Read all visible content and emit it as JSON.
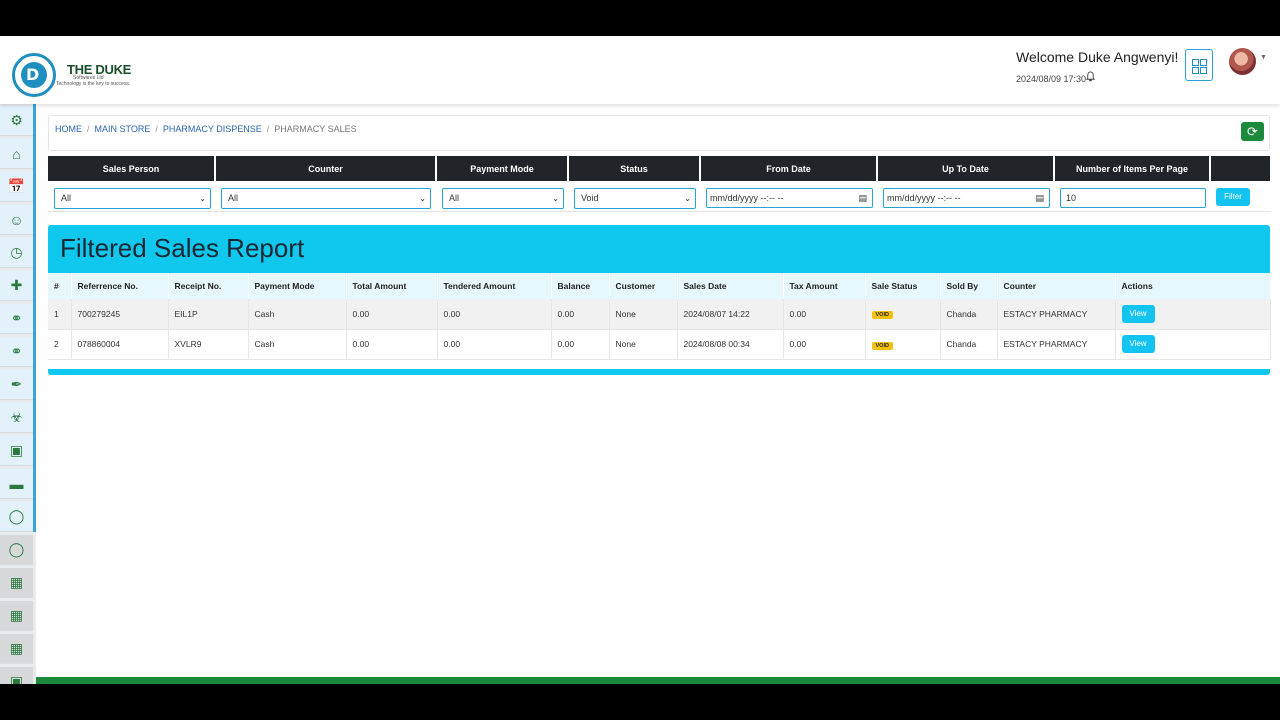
{
  "brand": {
    "name": "THE DUKE",
    "sub": "Softwares Ltd",
    "tagline": "Technology is the key to success.",
    "logo_letter": "D"
  },
  "header": {
    "welcome": "Welcome Duke Angwenyi!",
    "datetime": "2024/08/09 17:30",
    "bell_icon": "bell-icon",
    "apps_icon": "windows-grid-icon"
  },
  "sidebar": {
    "items": [
      {
        "icon": "settings-gear-icon"
      },
      {
        "icon": "home-icon"
      },
      {
        "icon": "calendar-icon"
      },
      {
        "icon": "user-add-icon"
      },
      {
        "icon": "calendar-clock-icon"
      },
      {
        "icon": "first-aid-icon"
      },
      {
        "icon": "stethoscope-icon"
      },
      {
        "icon": "stethoscope-icon"
      },
      {
        "icon": "syringe-icon"
      },
      {
        "icon": "microscope-icon"
      },
      {
        "icon": "monitor-icon"
      },
      {
        "icon": "bed-icon"
      },
      {
        "icon": "pill-icon"
      },
      {
        "icon": "pill-icon"
      },
      {
        "icon": "store-icon"
      },
      {
        "icon": "store-icon"
      },
      {
        "icon": "store-icon"
      },
      {
        "icon": "id-card-icon"
      }
    ]
  },
  "breadcrumb": {
    "items": [
      "HOME",
      "MAIN STORE",
      "PHARMACY DISPENSE",
      "PHARMACY SALES"
    ]
  },
  "filters": {
    "headers": [
      "Sales Person",
      "Counter",
      "Payment Mode",
      "Status",
      "From Date",
      "Up To Date",
      "Number of Items Per Page"
    ],
    "sales_person": "All",
    "counter": "All",
    "payment_mode": "All",
    "status": "Void",
    "from_date": "mm/dd/yyyy --:-- --",
    "to_date": "mm/dd/yyyy --:-- --",
    "items_per_page": "10",
    "filter_label": "Filter"
  },
  "report": {
    "title": "Filtered Sales Report",
    "columns": [
      "#",
      "Referrence No.",
      "Receipt No.",
      "Payment Mode",
      "Total Amount",
      "Tendered Amount",
      "Balance",
      "Customer",
      "Sales Date",
      "Tax Amount",
      "Sale Status",
      "Sold By",
      "Counter",
      "Actions"
    ],
    "rows": [
      {
        "num": "1",
        "ref": "700279245",
        "receipt": "EIL1P",
        "mode": "Cash",
        "total": "0.00",
        "tendered": "0.00",
        "balance": "0.00",
        "customer": "None",
        "date": "2024/08/07 14:22",
        "tax": "0.00",
        "status": "VOID",
        "sold_by": "Chanda",
        "counter": "ESTACY PHARMACY",
        "action": "View"
      },
      {
        "num": "2",
        "ref": "078860004",
        "receipt": "XVLR9",
        "mode": "Cash",
        "total": "0.00",
        "tendered": "0.00",
        "balance": "0.00",
        "customer": "None",
        "date": "2024/08/08 00:34",
        "tax": "0.00",
        "status": "VOID",
        "sold_by": "Chanda",
        "counter": "ESTACY PHARMACY",
        "action": "View"
      }
    ]
  },
  "colors": {
    "accent": "#10c8ee",
    "green": "#1b8a3a",
    "badge": "#f3c10d",
    "header_dark": "#212529"
  }
}
